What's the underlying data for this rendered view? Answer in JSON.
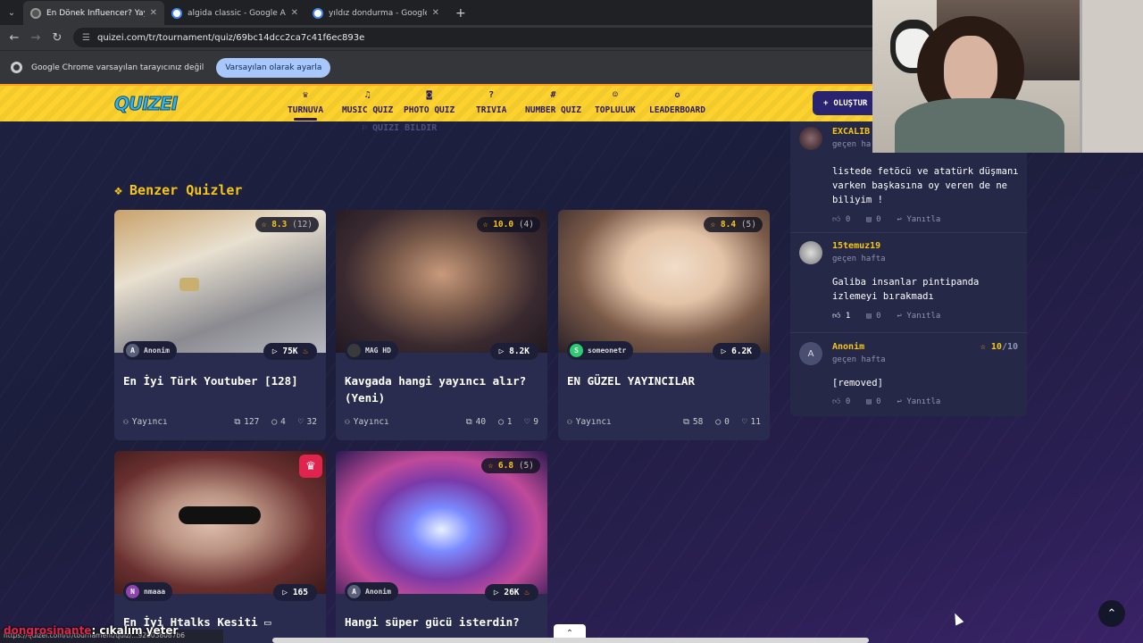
{
  "browser": {
    "tabs": [
      {
        "title": "En Dönek Influencer? Yayıncılar",
        "active": true
      },
      {
        "title": "algida classic - Google Alışveriş",
        "active": false
      },
      {
        "title": "yıldız dondurma - Google'da Ara",
        "active": false
      }
    ],
    "url": "quizei.com/tr/tournament/quiz/69bc14dcc2ca7c41f6ec893e",
    "infobar_text": "Google Chrome varsayılan tarayıcınız değil",
    "infobar_button": "Varsayılan olarak ayarla",
    "status_url": "https://quizei.com/tr/tournament/quiz/...92b038087b6"
  },
  "site": {
    "logo": "QUIZEI",
    "nav": [
      {
        "label": "TURNUVA",
        "icon": "trophy-icon",
        "active": true
      },
      {
        "label": "MUSIC QUIZ",
        "icon": "music-note-icon",
        "active": false
      },
      {
        "label": "PHOTO QUIZ",
        "icon": "camera-icon",
        "active": false
      },
      {
        "label": "TRIVIA",
        "icon": "question-icon",
        "active": false
      },
      {
        "label": "NUMBER QUIZ",
        "icon": "hash-icon",
        "active": false
      },
      {
        "label": "TOPLULUK",
        "icon": "people-icon",
        "active": false
      },
      {
        "label": "LEADERBOARD",
        "icon": "award-icon",
        "active": false
      }
    ],
    "create_button": "OLUŞTUR"
  },
  "report_link": "QUIZI BILDIR",
  "similar_heading": "Benzer Quizler",
  "cards": [
    {
      "title": "En İyi Türk Youtuber [128]",
      "rating": "8.3",
      "rating_count": "(12)",
      "author": "Anonim",
      "author_initial": "A",
      "plays": "75K",
      "hot": true,
      "category": "Yayıncı",
      "items": "127",
      "comments": "4",
      "likes": "32"
    },
    {
      "title": "Kavgada hangi yayıncı alır? (Yeni)",
      "rating": "10.0",
      "rating_count": "(4)",
      "author": "MAG HD",
      "author_initial": "",
      "plays": "8.2K",
      "hot": false,
      "category": "Yayıncı",
      "items": "40",
      "comments": "1",
      "likes": "9"
    },
    {
      "title": "EN GÜZEL YAYINCILAR",
      "rating": "8.4",
      "rating_count": "(5)",
      "author": "someonetr",
      "author_initial": "S",
      "plays": "6.2K",
      "hot": false,
      "category": "Yayıncı",
      "items": "58",
      "comments": "0",
      "likes": "11"
    },
    {
      "title": "En İyi Htalks Kesiti",
      "rating": "",
      "rating_count": "",
      "author": "nmaaa",
      "author_initial": "N",
      "plays": "165",
      "hot": false,
      "category": "",
      "items": "",
      "comments": "",
      "likes": ""
    },
    {
      "title": "Hangi süper gücü isterdin?",
      "rating": "6.8",
      "rating_count": "(5)",
      "author": "Anonim",
      "author_initial": "A",
      "plays": "26K",
      "hot": true,
      "category": "",
      "items": "",
      "comments": "",
      "likes": ""
    }
  ],
  "comments": [
    {
      "user": "EXCALIB",
      "when": "geçen ha",
      "text": "listede fetöcü ve atatürk düşmanı varken başkasına oy veren de ne biliyim !",
      "likes": "0",
      "replies": "0",
      "reply_label": "Yanıtla",
      "score": "",
      "score_max": ""
    },
    {
      "user": "15temuz19",
      "when": "geçen hafta",
      "text": "Galiba insanlar pintipanda izlemeyi bırakmadı",
      "likes": "1",
      "replies": "0",
      "reply_label": "Yanıtla",
      "score": "",
      "score_max": ""
    },
    {
      "user": "Anonim",
      "when": "geçen hafta",
      "text": "[removed]",
      "likes": "0",
      "replies": "0",
      "reply_label": "Yanıtla",
      "score": "10",
      "score_max": "/10",
      "initial": "A"
    }
  ],
  "chat": {
    "name": "dongrosinante",
    "message": ": cıkalım yeter"
  },
  "colors": {
    "accent_yellow": "#fdd22e",
    "title_gold": "#f5c518",
    "card_bg": "#292c4e",
    "nav_text": "#2a1a5e"
  }
}
